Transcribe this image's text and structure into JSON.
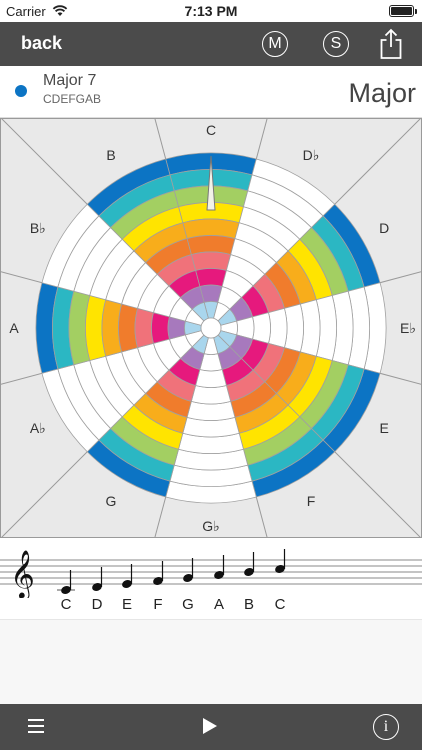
{
  "status_bar": {
    "carrier": "Carrier",
    "time": "7:13 PM"
  },
  "nav": {
    "back_label": "back",
    "m_label": "M",
    "s_label": "S"
  },
  "scale": {
    "name": "Major 7",
    "notes": "CDEFGAB",
    "type": "Major",
    "dot_color": "#0c74c4"
  },
  "wheel": {
    "note_labels": [
      "C",
      "D♭",
      "D",
      "E♭",
      "E",
      "F",
      "G♭",
      "G",
      "A♭",
      "A",
      "B♭",
      "B"
    ],
    "ring_colors": [
      "#0c74c4",
      "#2bb7c3",
      "#a3cf62",
      "#ffe400",
      "#f8ad1b",
      "#f07c2c",
      "#f0727a",
      "#e6197d",
      "#a779bd",
      "#a9d6ed"
    ],
    "active_notes": [
      "C",
      "D",
      "E",
      "F",
      "G",
      "A",
      "B"
    ],
    "background_color": "#e9e9e9"
  },
  "staff": {
    "notes": [
      "C",
      "D",
      "E",
      "F",
      "G",
      "A",
      "B",
      "C"
    ]
  },
  "bottom_bar": {
    "info_label": "i"
  }
}
